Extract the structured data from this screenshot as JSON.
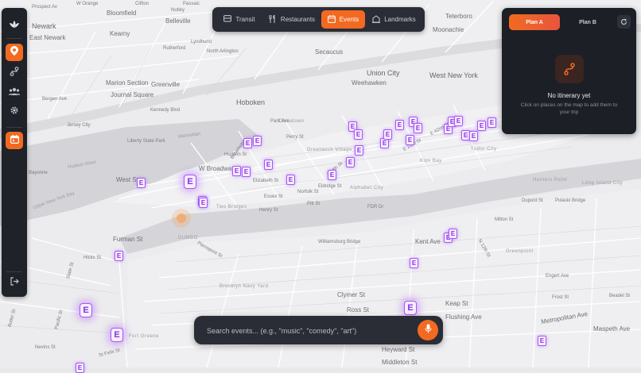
{
  "colors": {
    "accent": "#f26a21",
    "event_marker": "#a855f7",
    "panel_bg": "#1f2229",
    "map_bg": "#e9e9ea"
  },
  "nav": {
    "tabs": [
      {
        "label": "Transit",
        "icon": "bus-icon"
      },
      {
        "label": "Restaurants",
        "icon": "utensils-icon"
      },
      {
        "label": "Events",
        "icon": "calendar-icon",
        "active": true
      },
      {
        "label": "Landmarks",
        "icon": "landmark-icon"
      }
    ]
  },
  "sidebar": {
    "items": [
      {
        "name": "logo",
        "icon": "lotus-icon"
      },
      {
        "name": "map-pin",
        "icon": "map-pin-icon",
        "active": true
      },
      {
        "name": "route",
        "icon": "route-icon"
      },
      {
        "name": "users",
        "icon": "users-icon"
      },
      {
        "name": "settings",
        "icon": "gear-icon"
      },
      {
        "name": "calendar",
        "icon": "calendar-icon",
        "active": true
      },
      {
        "name": "logout",
        "icon": "logout-icon"
      }
    ]
  },
  "plan": {
    "tab_a": "Plan A",
    "tab_b": "Plan B",
    "empty_title": "No itinerary yet",
    "empty_desc": "Click on places on the map to add them to your trip"
  },
  "search": {
    "placeholder": "Search events... (e.g., \"music\", \"comedy\", \"art\")"
  },
  "event_marker_letter": "E",
  "map": {
    "labels": [
      "Prospect Av",
      "W Orange",
      "Bloomfield",
      "Belleville",
      "Nutley",
      "Clifton",
      "Passaic",
      "Newark",
      "East Newark",
      "Kearny",
      "Lyndhurst",
      "North Arlington",
      "Rutherford",
      "Secaucus",
      "Moonachie",
      "Teterboro",
      "Union City",
      "West New York",
      "Weehawken",
      "Hoboken",
      "Jersey City",
      "Bergen Ave",
      "Kennedy Blvd",
      "Journal Square",
      "Marion Section",
      "Greenville",
      "Bayonne",
      "Liberty State Park",
      "Hudson River",
      "Upper New York Bay",
      "Manhattan",
      "West St",
      "W Broadway",
      "Elizabeth St",
      "Broadway",
      "Greenwich Village",
      "Alphabet City",
      "Two Bridges",
      "Chinatown",
      "DUMBO",
      "Brooklyn Navy Yard",
      "Fort Greene",
      "Williamsburg Bridge",
      "Kips Bay",
      "Tudor City",
      "Long Island City",
      "Hunters Point",
      "Greenpoint",
      "Kent Ave",
      "Furman St",
      "Hicks St",
      "Pierrepont St",
      "Flushing Ave",
      "Metropolitan Ave",
      "Ross St",
      "Clymer St",
      "Heyward St",
      "Middleton St",
      "Keap St",
      "Maspeth Ave",
      "Dupont St",
      "Pulaski Bridge",
      "Milton St",
      "Frost St",
      "Engert Ave",
      "Beadel St",
      "Nevins St",
      "St Felix St",
      "Butler St",
      "Pacific St",
      "State St",
      "N 12th St",
      "E 23rd St",
      "E 42nd St",
      "Park Ave",
      "Essex St",
      "Norfolk St",
      "Pitt St",
      "Henry St",
      "FDR Dr",
      "Perry St",
      "W 4th St",
      "Hudson St",
      "Eldridge St"
    ]
  }
}
